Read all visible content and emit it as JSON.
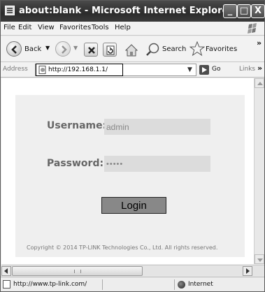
{
  "window": {
    "title": "about:blank - Microsoft Internet Explorer",
    "controls": {
      "minimize": "_",
      "maximize": "□",
      "close": "X"
    }
  },
  "menubar": {
    "items": [
      "File",
      "Edit",
      "View",
      "Favorites",
      "Tools",
      "Help"
    ]
  },
  "toolbar": {
    "back_label": "Back",
    "search_label": "Search",
    "favorites_label": "Favorites",
    "overflow": "»"
  },
  "addressbar": {
    "label": "Address",
    "url": "http://192.168.1.1/",
    "go_label": "Go",
    "links_label": "Links",
    "links_overflow": "»"
  },
  "login": {
    "username_label": "Username:",
    "username_value": "admin",
    "password_label": "Password:",
    "password_value": "•••••",
    "login_button": "Login",
    "copyright": "Copyright © 2014 TP-LINK Technologies Co., Ltd. All rights reserved."
  },
  "statusbar": {
    "url": "http://www.tp-link.com/",
    "zone": "Internet"
  },
  "colors": {
    "titlebar": "#333333",
    "panel_bg": "#efefef",
    "input_bg": "#dcdcdc",
    "label_text": "#666666",
    "button_bg": "#888888"
  }
}
